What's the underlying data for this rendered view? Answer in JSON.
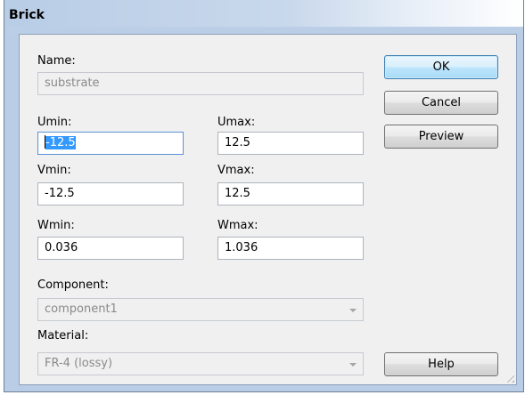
{
  "window": {
    "title": "Brick"
  },
  "form": {
    "name": {
      "label": "Name:",
      "value": "substrate"
    },
    "umin": {
      "label": "Umin:",
      "value": "-12.5"
    },
    "umax": {
      "label": "Umax:",
      "value": "12.5"
    },
    "vmin": {
      "label": "Vmin:",
      "value": "-12.5"
    },
    "vmax": {
      "label": "Vmax:",
      "value": "12.5"
    },
    "wmin": {
      "label": "Wmin:",
      "value": "0.036"
    },
    "wmax": {
      "label": "Wmax:",
      "value": "1.036"
    },
    "component": {
      "label": "Component:",
      "value": "component1"
    },
    "material": {
      "label": "Material:",
      "value": "FR-4 (lossy)"
    }
  },
  "buttons": {
    "ok": "OK",
    "cancel": "Cancel",
    "preview": "Preview",
    "help": "Help"
  }
}
